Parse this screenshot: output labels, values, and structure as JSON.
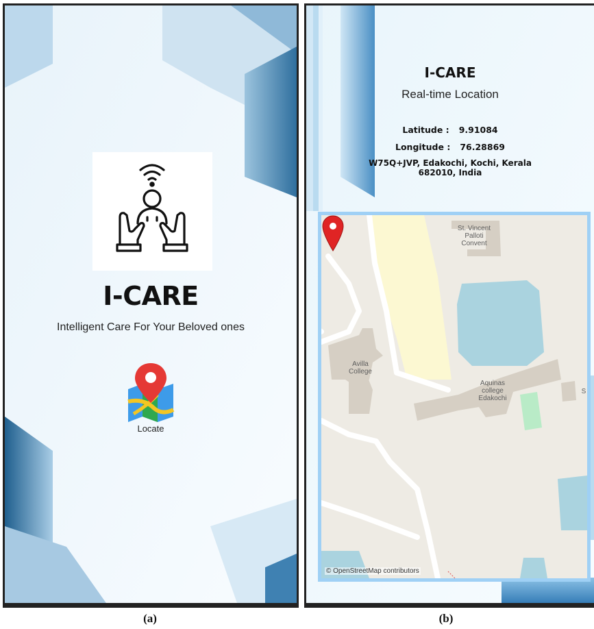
{
  "panel_a": {
    "caption": "(a)",
    "app_title": "I-CARE",
    "tagline": "Intelligent Care For Your Beloved ones",
    "locate_label": "Locate",
    "logo_icon": "care-hands-wifi-icon",
    "locate_icon": "map-pin-icon"
  },
  "panel_b": {
    "caption": "(b)",
    "app_title": "I-CARE",
    "subtitle": "Real-time Location",
    "latitude_label": "Latitude :",
    "latitude_value": "9.91084",
    "longitude_label": "Longitude :",
    "longitude_value": "76.28869",
    "address_line1": "W75Q+JVP, Edakochi, Kochi, Kerala",
    "address_line2": "682010, India",
    "map": {
      "labels": {
        "convent_1": "St. Vincent",
        "convent_2": "Palloti",
        "convent_3": "Convent",
        "avilla_1": "Avilla",
        "avilla_2": "College",
        "aquinas_1": "Aquinas",
        "aquinas_2": "college",
        "aquinas_3": "Edakochi",
        "edge_char": "S"
      },
      "attribution": "© OpenStreetMap contributors"
    }
  },
  "colors": {
    "accent_blue": "#1e6fa8",
    "pin_red": "#e02424",
    "map_water": "#aad3df",
    "map_building": "#d6cfc4",
    "map_park": "#c8f0c8"
  }
}
